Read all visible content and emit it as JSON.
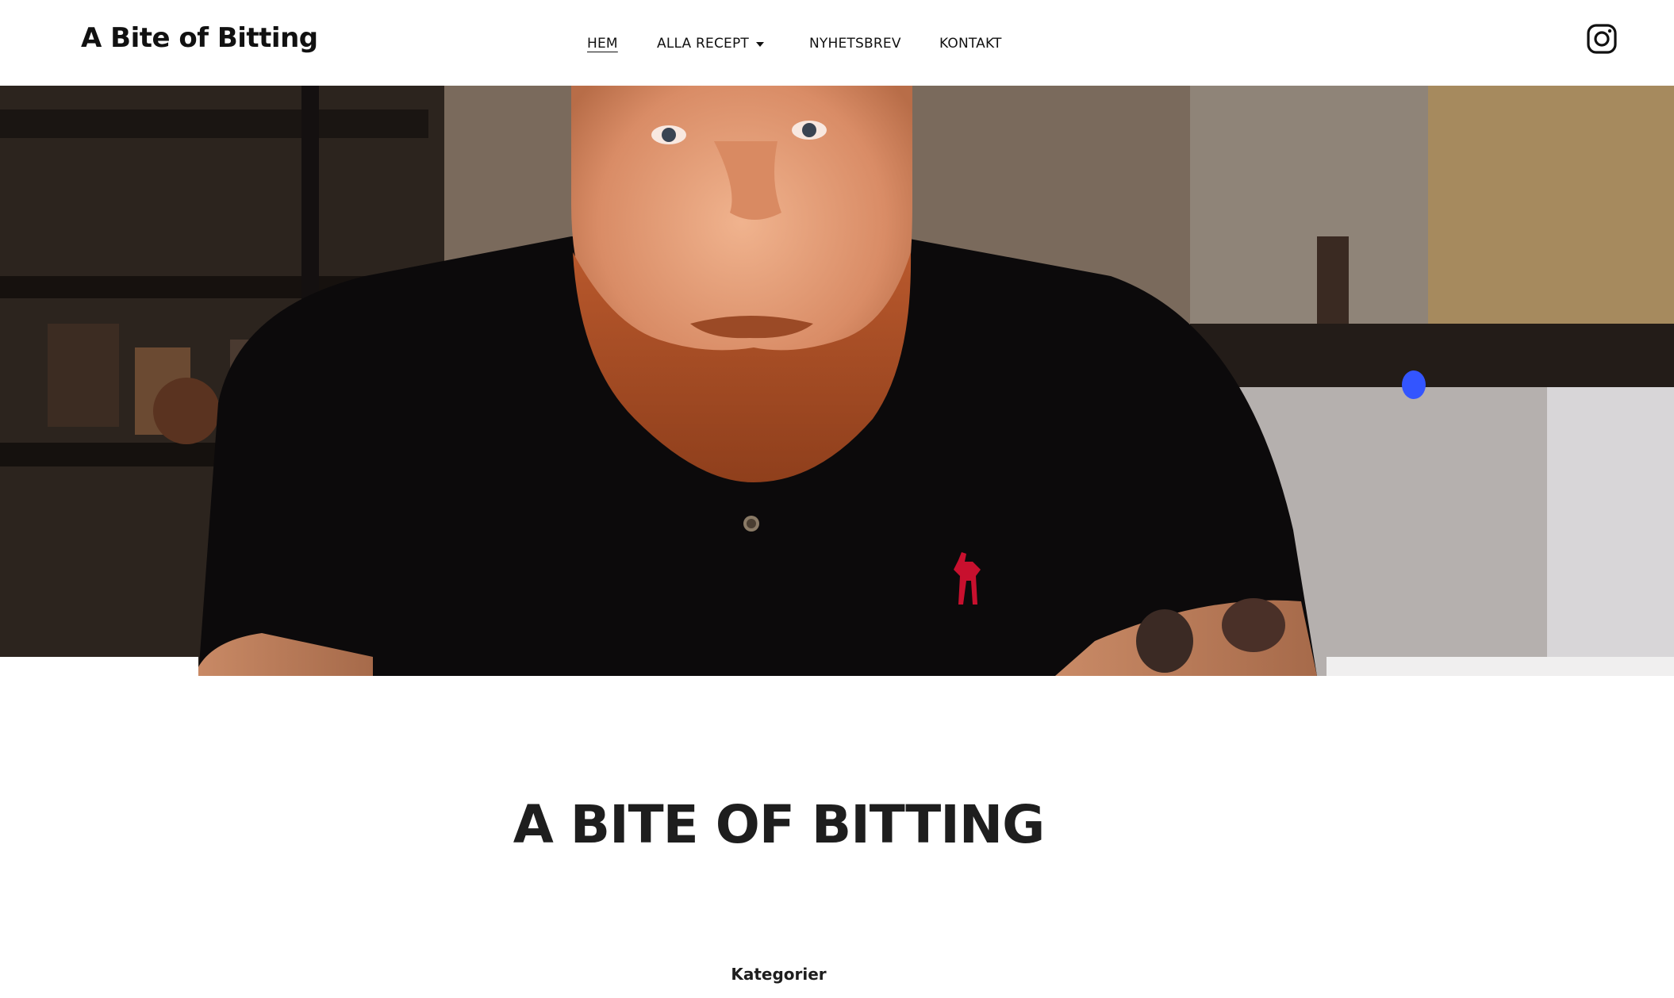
{
  "header": {
    "site_title": "A Bite of Bitting",
    "nav": [
      {
        "label": "HEM",
        "current": true
      },
      {
        "label": "ALLA RECEPT",
        "has_dropdown": true
      },
      {
        "label": "NYHETSBREV"
      },
      {
        "label": "KONTAKT"
      }
    ],
    "social_icon": "instagram-icon"
  },
  "hero": {
    "image": "portrait of bearded man in black polo shirt in a kitchen"
  },
  "main": {
    "title": "A BITE OF BITTING",
    "categories_heading": "Kategorier"
  },
  "colors": {
    "text": "#111111",
    "heading": "#1e1e1e",
    "background": "#ffffff",
    "logo_red": "#c8102e"
  }
}
